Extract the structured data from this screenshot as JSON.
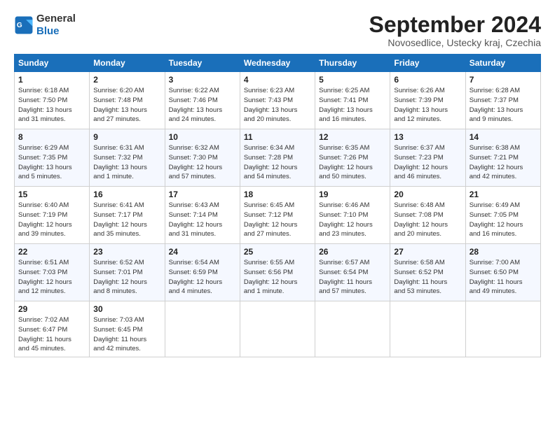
{
  "header": {
    "logo_general": "General",
    "logo_blue": "Blue",
    "title": "September 2024",
    "location": "Novosedlice, Ustecky kraj, Czechia"
  },
  "weekdays": [
    "Sunday",
    "Monday",
    "Tuesday",
    "Wednesday",
    "Thursday",
    "Friday",
    "Saturday"
  ],
  "weeks": [
    [
      {
        "day": "1",
        "info": "Sunrise: 6:18 AM\nSunset: 7:50 PM\nDaylight: 13 hours\nand 31 minutes."
      },
      {
        "day": "2",
        "info": "Sunrise: 6:20 AM\nSunset: 7:48 PM\nDaylight: 13 hours\nand 27 minutes."
      },
      {
        "day": "3",
        "info": "Sunrise: 6:22 AM\nSunset: 7:46 PM\nDaylight: 13 hours\nand 24 minutes."
      },
      {
        "day": "4",
        "info": "Sunrise: 6:23 AM\nSunset: 7:43 PM\nDaylight: 13 hours\nand 20 minutes."
      },
      {
        "day": "5",
        "info": "Sunrise: 6:25 AM\nSunset: 7:41 PM\nDaylight: 13 hours\nand 16 minutes."
      },
      {
        "day": "6",
        "info": "Sunrise: 6:26 AM\nSunset: 7:39 PM\nDaylight: 13 hours\nand 12 minutes."
      },
      {
        "day": "7",
        "info": "Sunrise: 6:28 AM\nSunset: 7:37 PM\nDaylight: 13 hours\nand 9 minutes."
      }
    ],
    [
      {
        "day": "8",
        "info": "Sunrise: 6:29 AM\nSunset: 7:35 PM\nDaylight: 13 hours\nand 5 minutes."
      },
      {
        "day": "9",
        "info": "Sunrise: 6:31 AM\nSunset: 7:32 PM\nDaylight: 13 hours\nand 1 minute."
      },
      {
        "day": "10",
        "info": "Sunrise: 6:32 AM\nSunset: 7:30 PM\nDaylight: 12 hours\nand 57 minutes."
      },
      {
        "day": "11",
        "info": "Sunrise: 6:34 AM\nSunset: 7:28 PM\nDaylight: 12 hours\nand 54 minutes."
      },
      {
        "day": "12",
        "info": "Sunrise: 6:35 AM\nSunset: 7:26 PM\nDaylight: 12 hours\nand 50 minutes."
      },
      {
        "day": "13",
        "info": "Sunrise: 6:37 AM\nSunset: 7:23 PM\nDaylight: 12 hours\nand 46 minutes."
      },
      {
        "day": "14",
        "info": "Sunrise: 6:38 AM\nSunset: 7:21 PM\nDaylight: 12 hours\nand 42 minutes."
      }
    ],
    [
      {
        "day": "15",
        "info": "Sunrise: 6:40 AM\nSunset: 7:19 PM\nDaylight: 12 hours\nand 39 minutes."
      },
      {
        "day": "16",
        "info": "Sunrise: 6:41 AM\nSunset: 7:17 PM\nDaylight: 12 hours\nand 35 minutes."
      },
      {
        "day": "17",
        "info": "Sunrise: 6:43 AM\nSunset: 7:14 PM\nDaylight: 12 hours\nand 31 minutes."
      },
      {
        "day": "18",
        "info": "Sunrise: 6:45 AM\nSunset: 7:12 PM\nDaylight: 12 hours\nand 27 minutes."
      },
      {
        "day": "19",
        "info": "Sunrise: 6:46 AM\nSunset: 7:10 PM\nDaylight: 12 hours\nand 23 minutes."
      },
      {
        "day": "20",
        "info": "Sunrise: 6:48 AM\nSunset: 7:08 PM\nDaylight: 12 hours\nand 20 minutes."
      },
      {
        "day": "21",
        "info": "Sunrise: 6:49 AM\nSunset: 7:05 PM\nDaylight: 12 hours\nand 16 minutes."
      }
    ],
    [
      {
        "day": "22",
        "info": "Sunrise: 6:51 AM\nSunset: 7:03 PM\nDaylight: 12 hours\nand 12 minutes."
      },
      {
        "day": "23",
        "info": "Sunrise: 6:52 AM\nSunset: 7:01 PM\nDaylight: 12 hours\nand 8 minutes."
      },
      {
        "day": "24",
        "info": "Sunrise: 6:54 AM\nSunset: 6:59 PM\nDaylight: 12 hours\nand 4 minutes."
      },
      {
        "day": "25",
        "info": "Sunrise: 6:55 AM\nSunset: 6:56 PM\nDaylight: 12 hours\nand 1 minute."
      },
      {
        "day": "26",
        "info": "Sunrise: 6:57 AM\nSunset: 6:54 PM\nDaylight: 11 hours\nand 57 minutes."
      },
      {
        "day": "27",
        "info": "Sunrise: 6:58 AM\nSunset: 6:52 PM\nDaylight: 11 hours\nand 53 minutes."
      },
      {
        "day": "28",
        "info": "Sunrise: 7:00 AM\nSunset: 6:50 PM\nDaylight: 11 hours\nand 49 minutes."
      }
    ],
    [
      {
        "day": "29",
        "info": "Sunrise: 7:02 AM\nSunset: 6:47 PM\nDaylight: 11 hours\nand 45 minutes."
      },
      {
        "day": "30",
        "info": "Sunrise: 7:03 AM\nSunset: 6:45 PM\nDaylight: 11 hours\nand 42 minutes."
      },
      {
        "day": "",
        "info": ""
      },
      {
        "day": "",
        "info": ""
      },
      {
        "day": "",
        "info": ""
      },
      {
        "day": "",
        "info": ""
      },
      {
        "day": "",
        "info": ""
      }
    ]
  ]
}
